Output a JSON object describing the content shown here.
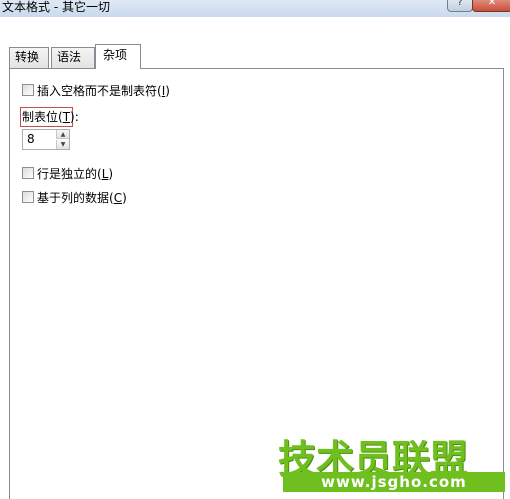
{
  "window": {
    "title": "文本格式 - 其它一切",
    "help_label": "?",
    "close_label": "✕"
  },
  "tabs": [
    {
      "label": "转换",
      "active": false
    },
    {
      "label": "语法",
      "active": false
    },
    {
      "label": "杂项",
      "active": true
    }
  ],
  "panel": {
    "insert_spaces": {
      "label": "插入空格而不是制表符(",
      "key": "I",
      "close": ")",
      "checked": false
    },
    "tab_stop": {
      "label": "制表位(",
      "key": "T",
      "close": "):",
      "value": "8"
    },
    "line_independent": {
      "label": "行是独立的(",
      "key": "L",
      "close": ")",
      "checked": false
    },
    "column_based": {
      "label": "基于列的数据(",
      "key": "C",
      "close": ")",
      "checked": false
    }
  },
  "watermark": {
    "logo_text": "技术员联盟",
    "url": "www.jsgho.com",
    "color": "#6fbf1f"
  }
}
